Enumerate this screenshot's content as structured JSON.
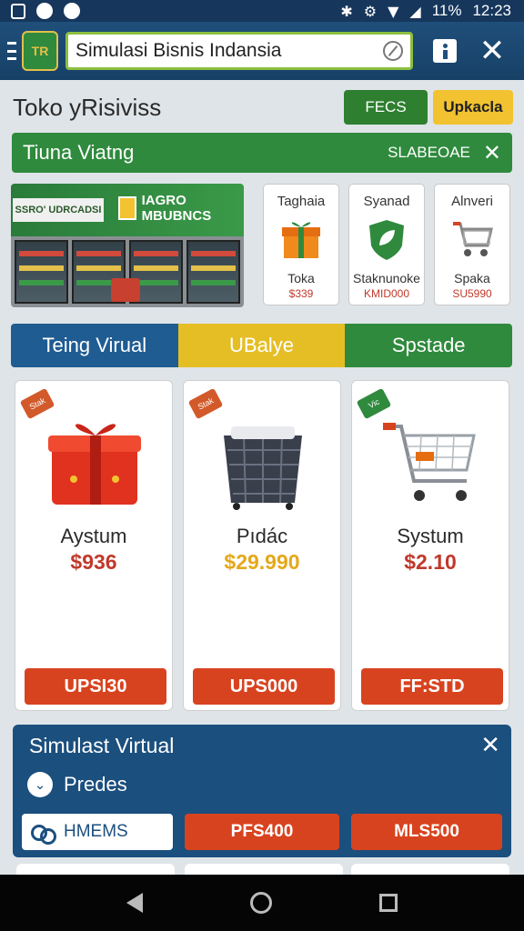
{
  "status_bar": {
    "battery": "11%",
    "time": "12:23"
  },
  "app_bar": {
    "search_value": "Simulasi Bisnis Indansia"
  },
  "header": {
    "title": "Toko yRisiviss",
    "button_green": "FECS",
    "button_yellow": "Upkacla"
  },
  "banner": {
    "title": "Tiuna Viatng",
    "code": "SLABEOAE"
  },
  "storefront": {
    "sign_left": "SSRO' UDRCADSI",
    "sign_right": "IAGRO MBUBNCS"
  },
  "mini_cards": [
    {
      "header": "Taghaia",
      "name": "Toka",
      "price": "$339"
    },
    {
      "header": "Syanad",
      "name": "Staknunoke",
      "price": "KMID000"
    },
    {
      "header": "Alnveri",
      "name": "Spaka",
      "price": "SU5990"
    }
  ],
  "tabs": [
    "Teing Virual",
    "UBalye",
    "Spstade"
  ],
  "products": [
    {
      "tag": "Stak",
      "name": "Aystum",
      "price": "$936",
      "price_color": "#c0392b",
      "button": "UPSI30"
    },
    {
      "tag": "Stak",
      "name": "Pıdác",
      "price": "$29.990",
      "price_color": "#e5a81a",
      "button": "UPS000"
    },
    {
      "tag": "Vic",
      "name": "Systum",
      "price": "$2.10",
      "price_color": "#c0392b",
      "button": "FF:STD"
    }
  ],
  "panel": {
    "title": "Simulast Virtual",
    "subtitle": "Predes",
    "button_1": "HMEMS",
    "button_2": "PFS400",
    "button_3": "MLS500"
  },
  "colors": {
    "brand_blue": "#1f4f7a",
    "brand_green": "#2f8a3d",
    "accent_yellow": "#e5be26",
    "cta_red": "#d8431f"
  }
}
